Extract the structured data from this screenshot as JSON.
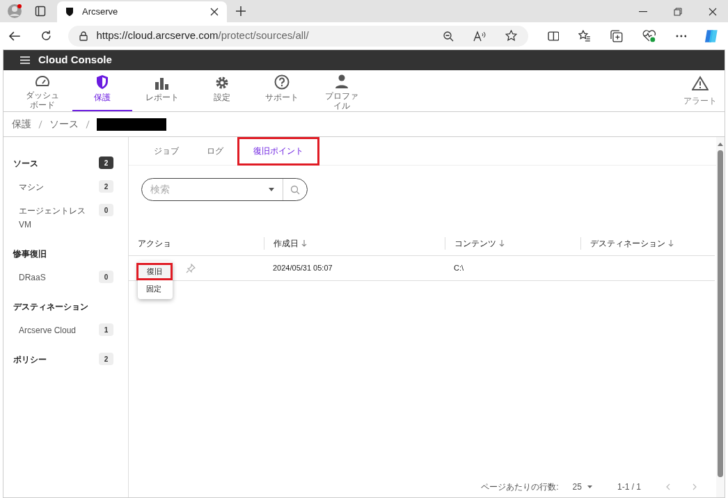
{
  "browser": {
    "tab_title": "Arcserve",
    "url_host": "https://cloud.arcserve.com",
    "url_path": "/protect/sources/all/"
  },
  "app": {
    "title": "Cloud Console"
  },
  "nav": [
    {
      "label": "ダッシュボード",
      "selected": false
    },
    {
      "label": "保護",
      "selected": true
    },
    {
      "label": "レポート",
      "selected": false
    },
    {
      "label": "設定",
      "selected": false
    },
    {
      "label": "サポート",
      "selected": false
    },
    {
      "label": "プロファイル",
      "selected": false
    }
  ],
  "alert": {
    "label": "アラート"
  },
  "breadcrumb": [
    "保護",
    "ソース"
  ],
  "sidebar": [
    {
      "label": "ソース",
      "kind": "section",
      "count": "2",
      "selected": true
    },
    {
      "label": "マシン",
      "kind": "item",
      "count": "2",
      "selected": false
    },
    {
      "label": "エージェントレス VM",
      "kind": "item",
      "count": "0",
      "selected": false
    },
    {
      "label": "惨事復旧",
      "kind": "section"
    },
    {
      "label": "DRaaS",
      "kind": "item",
      "count": "0",
      "selected": false
    },
    {
      "label": "デスティネーション",
      "kind": "section"
    },
    {
      "label": "Arcserve Cloud",
      "kind": "item",
      "count": "1",
      "selected": false
    },
    {
      "label": "ポリシー",
      "kind": "section",
      "count": "2",
      "selected": false
    }
  ],
  "tabs": [
    {
      "label": "ジョブ",
      "selected": false,
      "highlighted": false
    },
    {
      "label": "ログ",
      "selected": false,
      "highlighted": false
    },
    {
      "label": "復旧ポイント",
      "selected": true,
      "highlighted": true
    }
  ],
  "search": {
    "placeholder": "検索"
  },
  "table": {
    "columns": [
      {
        "label": "アクショ",
        "sortable": false
      },
      {
        "label": "作成日",
        "sortable": true
      },
      {
        "label": "コンテンツ",
        "sortable": true
      },
      {
        "label": "デスティネーション",
        "sortable": true
      }
    ],
    "rows": [
      {
        "created": "2024/05/31 05:07",
        "contents": "C:\\"
      }
    ]
  },
  "menu": [
    {
      "label": "復旧",
      "highlighted": true
    },
    {
      "label": "固定",
      "highlighted": false
    }
  ],
  "pagination": {
    "rows_label": "ページあたりの行数:",
    "page_size": "25",
    "range": "1-1 / 1"
  }
}
